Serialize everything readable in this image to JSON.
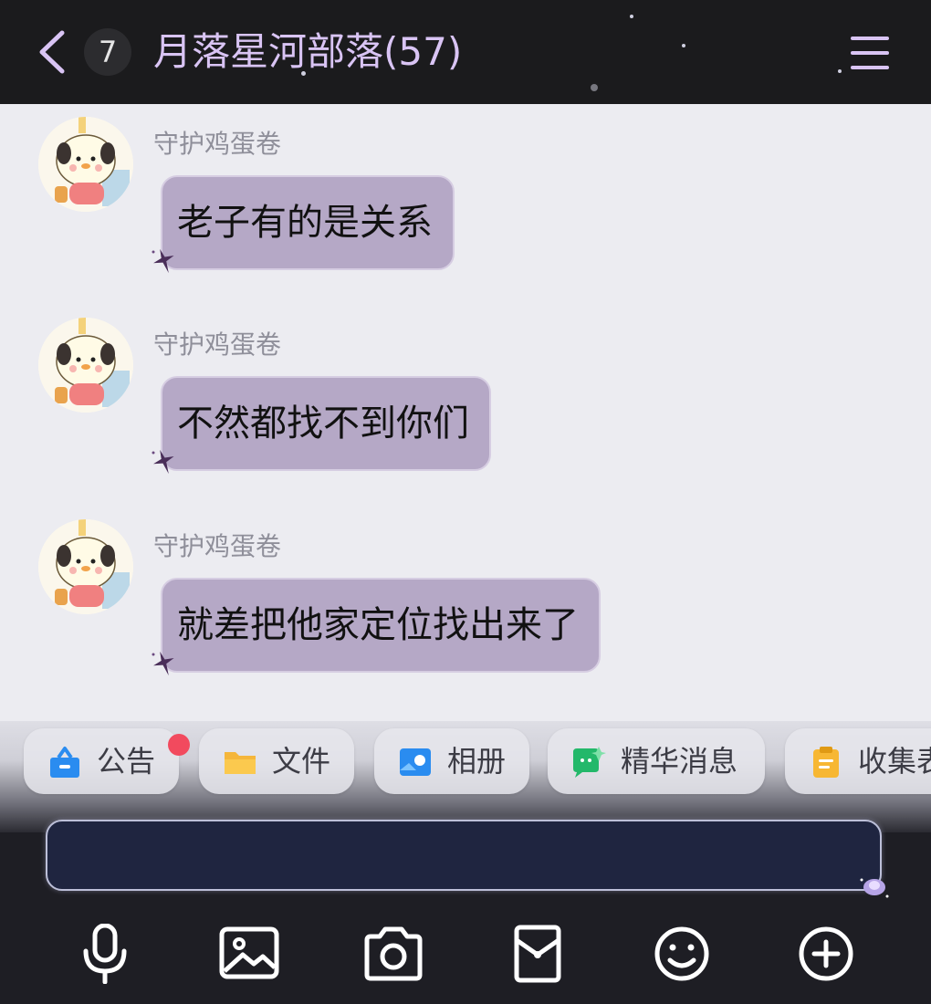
{
  "header": {
    "back_icon": "chevron-left-icon",
    "unread_count": "7",
    "title": "月落星河部落(57)",
    "menu_icon": "hamburger-menu-icon",
    "accent_color": "#d9c4f4",
    "background_color": "#1b1b1d"
  },
  "messages": [
    {
      "sender": "守护鸡蛋卷",
      "text": "老子有的是关系"
    },
    {
      "sender": "守护鸡蛋卷",
      "text": "不然都找不到你们"
    },
    {
      "sender": "守护鸡蛋卷",
      "text": "就差把他家定位找出来了"
    }
  ],
  "bubble_color": "#b5a8c6",
  "shortcuts": [
    {
      "label": "公告",
      "icon": "announcement-icon",
      "has_badge": true
    },
    {
      "label": "文件",
      "icon": "folder-icon"
    },
    {
      "label": "相册",
      "icon": "photo-album-icon"
    },
    {
      "label": "精华消息",
      "icon": "highlight-message-icon"
    },
    {
      "label": "收集表",
      "icon": "clipboard-icon"
    }
  ],
  "input": {
    "value": "",
    "placeholder": ""
  },
  "toolbar": [
    "microphone-icon",
    "image-icon",
    "camera-icon",
    "red-packet-icon",
    "emoji-icon",
    "plus-icon"
  ]
}
